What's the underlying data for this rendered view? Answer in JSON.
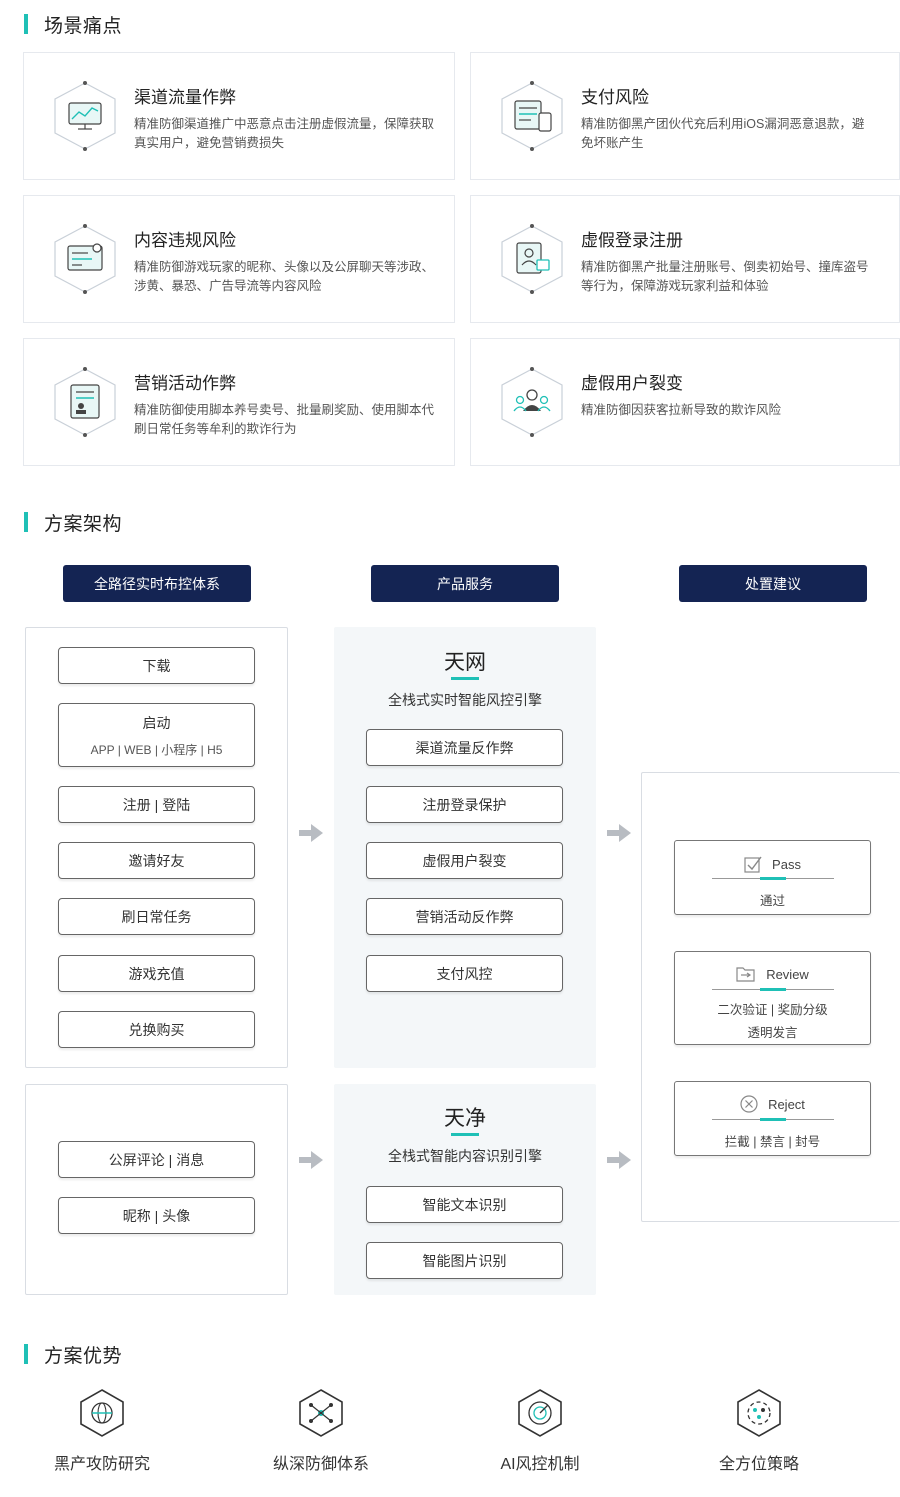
{
  "sections": {
    "pain": "场景痛点",
    "architecture": "方案架构",
    "advantages": "方案优势"
  },
  "pain_cards": [
    {
      "title": "渠道流量作弊",
      "desc": "精准防御渠道推广中恶意点击注册虚假流量，保障获取真实用户，避免营销费损失"
    },
    {
      "title": "支付风险",
      "desc": "精准防御黑产团伙代充后利用iOS漏洞恶意退款，避免坏账产生"
    },
    {
      "title": "内容违规风险",
      "desc": "精准防御游戏玩家的昵称、头像以及公屏聊天等涉政、涉黄、暴恐、广告导流等内容风险"
    },
    {
      "title": "虚假登录注册",
      "desc": "精准防御黑产批量注册账号、倒卖初始号、撞库盗号等行为，保障游戏玩家利益和体验"
    },
    {
      "title": "营销活动作弊",
      "desc": "精准防御使用脚本养号卖号、批量刷奖励、使用脚本代刷日常任务等牟利的欺诈行为"
    },
    {
      "title": "虚假用户裂变",
      "desc": "精准防御因获客拉新导致的欺诈风险"
    }
  ],
  "arch": {
    "col_headers": [
      "全路径实时布控体系",
      "产品服务",
      "处置建议"
    ],
    "left_top": {
      "download": "下载",
      "launch": "启动",
      "launch_sub": "APP | WEB | 小程序 | H5",
      "register": "注册 | 登陆",
      "invite": "邀请好友",
      "daily": "刷日常任务",
      "recharge": "游戏充值",
      "redeem": "兑换购买"
    },
    "left_bottom": [
      "公屏评论 | 消息",
      "昵称 | 头像"
    ],
    "tianwang": {
      "title": "天网",
      "subtitle": "全栈式实时智能风控引擎",
      "items": [
        "渠道流量反作弊",
        "注册登录保护",
        "虚假用户裂变",
        "营销活动反作弊",
        "支付风控"
      ]
    },
    "tianjing": {
      "title": "天净",
      "subtitle": "全栈式智能内容识别引擎",
      "items": [
        "智能文本识别",
        "智能图片识别"
      ]
    },
    "results": {
      "pass": {
        "label": "Pass",
        "desc": "通过"
      },
      "review": {
        "label": "Review",
        "desc1": "二次验证 | 奖励分级",
        "desc2": "透明发言"
      },
      "reject": {
        "label": "Reject",
        "desc": "拦截 | 禁言 | 封号"
      }
    }
  },
  "advantages": [
    "黑产攻防研究",
    "纵深防御体系",
    "AI风控机制",
    "全方位策略"
  ],
  "colors": {
    "accent": "#1fc0b6",
    "navy": "#142453"
  }
}
